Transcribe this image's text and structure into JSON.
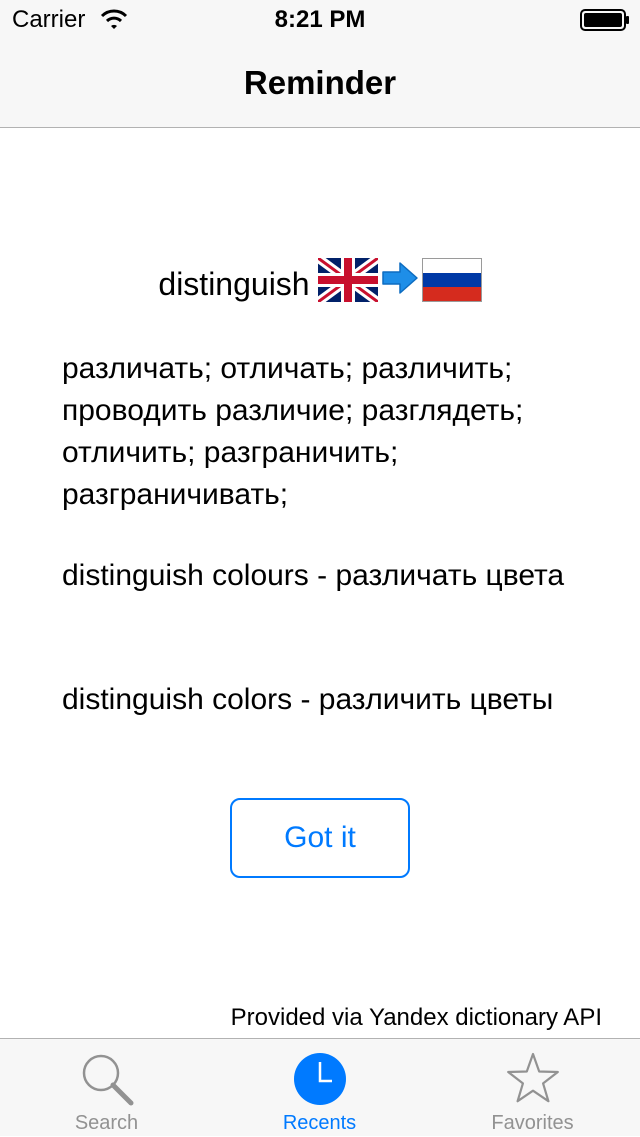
{
  "status_bar": {
    "carrier": "Carrier",
    "time": "8:21 PM"
  },
  "nav": {
    "title": "Reminder"
  },
  "entry": {
    "word": "distinguish",
    "source_flag": "uk-flag-icon",
    "arrow": "right-arrow-icon",
    "target_flag": "russia-flag-icon",
    "translations": "различать; отличать; различить; проводить различие; разглядеть; отличить; разграничить; разграничивать;",
    "examples": [
      "distinguish colours - различать цвета",
      "distinguish colors - различить цветы"
    ]
  },
  "actions": {
    "got_it_label": "Got it"
  },
  "footer": {
    "attribution": "Provided via Yandex dictionary API"
  },
  "tab_bar": {
    "tabs": [
      {
        "label": "Search",
        "icon": "search-icon",
        "selected": false
      },
      {
        "label": "Recents",
        "icon": "clock-icon",
        "selected": true
      },
      {
        "label": "Favorites",
        "icon": "star-icon",
        "selected": false
      }
    ]
  },
  "colors": {
    "accent": "#007aff",
    "tab_inactive": "#929292",
    "bar_background": "#f7f7f7",
    "separator": "#b2b2b2"
  }
}
